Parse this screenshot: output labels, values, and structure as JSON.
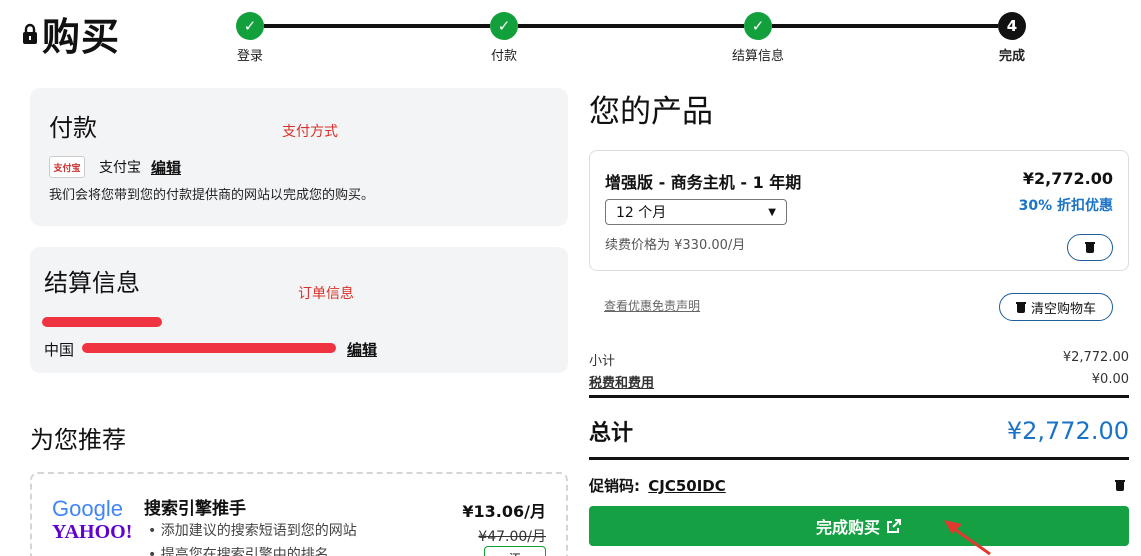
{
  "header": {
    "title": "购买"
  },
  "steps": [
    {
      "label": "登录",
      "status": "done"
    },
    {
      "label": "付款",
      "status": "done"
    },
    {
      "label": "结算信息",
      "status": "done"
    },
    {
      "label": "完成",
      "status": "current",
      "number": "4"
    }
  ],
  "payment": {
    "title": "付款",
    "annotation": "支付方式",
    "method_logo_text": "支付宝",
    "method_name": "支付宝",
    "edit_label": "编辑",
    "note": "我们会将您带到您的付款提供商的网站以完成您的购买。"
  },
  "billing": {
    "title": "结算信息",
    "annotation": "订单信息",
    "country": "中国",
    "edit_label": "编辑"
  },
  "recommend": {
    "title": "为您推荐",
    "item": {
      "logo_google": "Google",
      "logo_yahoo": "YAHOO!",
      "name": "搜索引擎推手",
      "bullets": [
        "添加建议的搜索短语到您的网站",
        "提高您在搜索引擎中的排名"
      ],
      "price": "¥13.06/月",
      "old_price": "¥47.00/月",
      "button_partial": "添"
    }
  },
  "products": {
    "title": "您的产品",
    "item": {
      "name": "增强版 - 商务主机 - 1 年期",
      "price": "¥2,772.00",
      "discount": "30% 折扣优惠",
      "term": "12 个月",
      "renewal": "续费价格为 ¥330.00/月"
    },
    "disclaimer_link": "查看优惠免责声明",
    "clear_cart": "清空购物车"
  },
  "summary": {
    "subtotal_label": "小计",
    "subtotal_value": "¥2,772.00",
    "tax_label": "税费和费用",
    "tax_value": "¥0.00",
    "total_label": "总计",
    "total_value": "¥2,772.00",
    "promo_label": "促销码:",
    "promo_code": "CJC50IDC",
    "finish_button": "完成购买"
  },
  "colors": {
    "accent_blue": "#1a73c7",
    "success_green": "#12a03c",
    "annotation_red": "#d6312a"
  }
}
